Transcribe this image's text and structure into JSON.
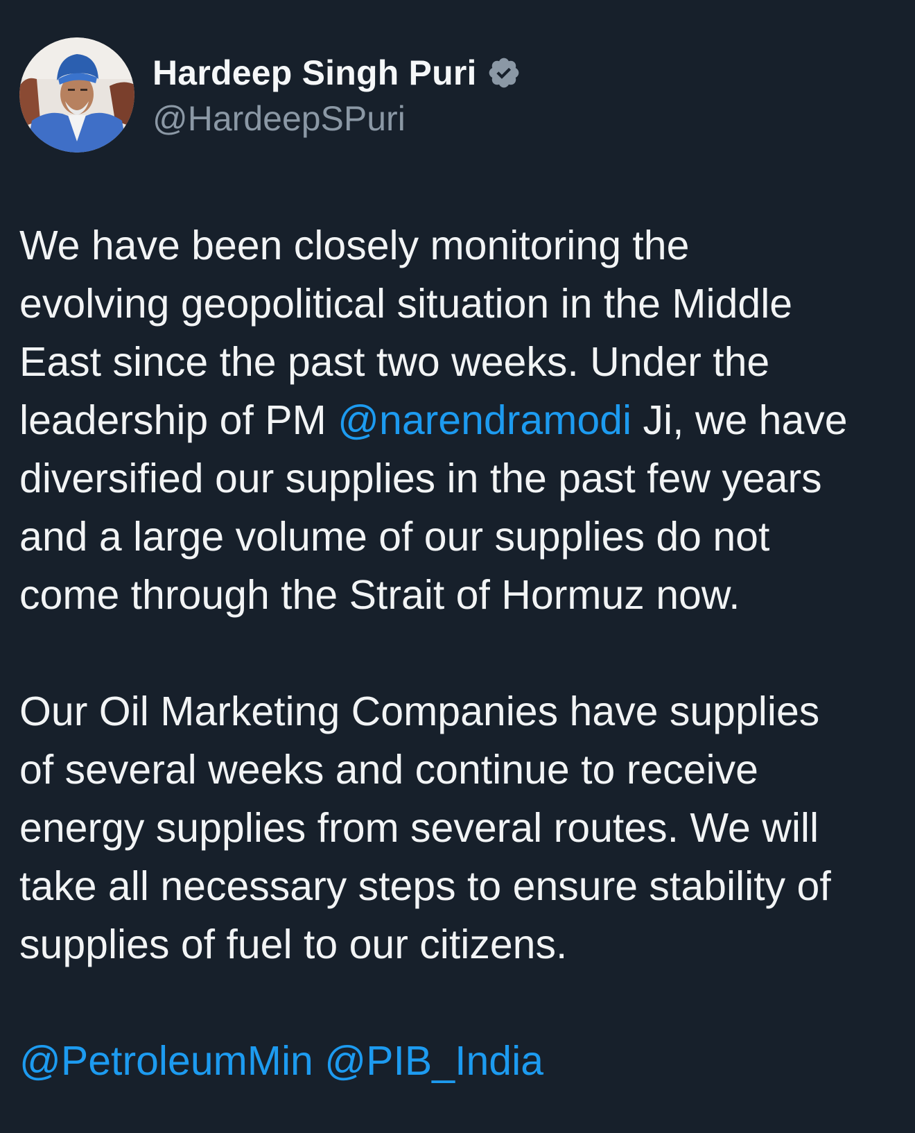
{
  "author": {
    "display_name": "Hardeep Singh Puri",
    "handle": "@HardeepSPuri",
    "verified_icon": "verified-badge-icon",
    "avatar": "profile-photo"
  },
  "colors": {
    "background": "#17202b",
    "text": "#f2f4f5",
    "muted": "#8b98a5",
    "mention": "#1d9bf0",
    "badge": "#8b98a5"
  },
  "tweet": {
    "p1": {
      "l1": "We have been closely monitoring the",
      "l2": "evolving geopolitical situation in the Middle",
      "l3": "East since the past two weeks. Under the",
      "l4_before": "leadership of PM ",
      "l4_mention": "@narendramodi",
      "l4_after": " Ji, we have",
      "l5": "diversified our supplies in the past few years",
      "l6": "and a large volume of our supplies do not",
      "l7": "come through the Strait of Hormuz now."
    },
    "p2": {
      "l1": "Our Oil Marketing Companies have supplies",
      "l2": "of several weeks and continue to receive",
      "l3": "energy supplies from several routes. We will",
      "l4": "take all necessary steps to ensure stability of",
      "l5": "supplies of fuel to our citizens."
    },
    "mentions": {
      "m1": "@PetroleumMin",
      "m2": "@PIB_India"
    }
  }
}
